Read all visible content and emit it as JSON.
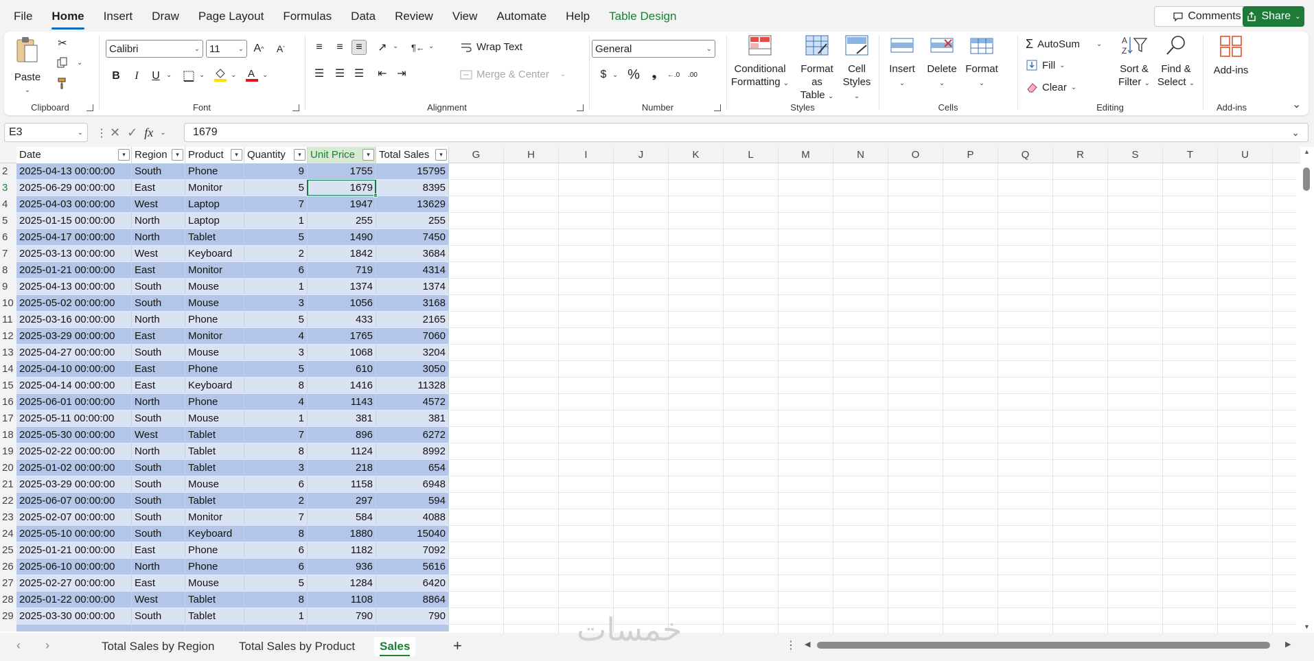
{
  "menu": {
    "tabs": [
      "File",
      "Home",
      "Insert",
      "Draw",
      "Page Layout",
      "Formulas",
      "Data",
      "Review",
      "View",
      "Automate",
      "Help",
      "Table Design"
    ],
    "comments_label": "Comments",
    "share_label": "Share"
  },
  "ribbon": {
    "clipboard": {
      "paste": "Paste",
      "label": "Clipboard"
    },
    "font": {
      "name": "Calibri",
      "size": "11",
      "label": "Font"
    },
    "alignment": {
      "wrap_text": "Wrap Text",
      "merge_center": "Merge & Center",
      "label": "Alignment"
    },
    "number": {
      "format": "General",
      "label": "Number"
    },
    "styles": {
      "conditional_1": "Conditional",
      "conditional_2": "Formatting",
      "format_table_1": "Format as",
      "format_table_2": "Table",
      "cell_styles_1": "Cell",
      "cell_styles_2": "Styles",
      "label": "Styles"
    },
    "cells": {
      "insert": "Insert",
      "delete": "Delete",
      "format": "Format",
      "label": "Cells"
    },
    "editing": {
      "autosum": "AutoSum",
      "fill": "Fill",
      "clear": "Clear",
      "sort_1": "Sort &",
      "sort_2": "Filter",
      "find_1": "Find &",
      "find_2": "Select",
      "label": "Editing"
    },
    "addins": {
      "addins": "Add-ins",
      "label": "Add-ins"
    }
  },
  "formula_bar": {
    "name_box": "E3",
    "value": "1679"
  },
  "columns": [
    "G",
    "H",
    "I",
    "J",
    "K",
    "L",
    "M",
    "N",
    "O",
    "P",
    "Q",
    "R",
    "S",
    "T",
    "U"
  ],
  "table": {
    "headers": [
      "Date",
      "Region",
      "Product",
      "Quantity",
      "Unit Price",
      "Total Sales"
    ],
    "rows": [
      [
        "2",
        "2025-04-13 00:00:00",
        "South",
        "Phone",
        "9",
        "1755",
        "15795"
      ],
      [
        "3",
        "2025-06-29 00:00:00",
        "East",
        "Monitor",
        "5",
        "1679",
        "8395"
      ],
      [
        "4",
        "2025-04-03 00:00:00",
        "West",
        "Laptop",
        "7",
        "1947",
        "13629"
      ],
      [
        "5",
        "2025-01-15 00:00:00",
        "North",
        "Laptop",
        "1",
        "255",
        "255"
      ],
      [
        "6",
        "2025-04-17 00:00:00",
        "North",
        "Tablet",
        "5",
        "1490",
        "7450"
      ],
      [
        "7",
        "2025-03-13 00:00:00",
        "West",
        "Keyboard",
        "2",
        "1842",
        "3684"
      ],
      [
        "8",
        "2025-01-21 00:00:00",
        "East",
        "Monitor",
        "6",
        "719",
        "4314"
      ],
      [
        "9",
        "2025-04-13 00:00:00",
        "South",
        "Mouse",
        "1",
        "1374",
        "1374"
      ],
      [
        "10",
        "2025-05-02 00:00:00",
        "South",
        "Mouse",
        "3",
        "1056",
        "3168"
      ],
      [
        "11",
        "2025-03-16 00:00:00",
        "North",
        "Phone",
        "5",
        "433",
        "2165"
      ],
      [
        "12",
        "2025-03-29 00:00:00",
        "East",
        "Monitor",
        "4",
        "1765",
        "7060"
      ],
      [
        "13",
        "2025-04-27 00:00:00",
        "South",
        "Mouse",
        "3",
        "1068",
        "3204"
      ],
      [
        "14",
        "2025-04-10 00:00:00",
        "East",
        "Phone",
        "5",
        "610",
        "3050"
      ],
      [
        "15",
        "2025-04-14 00:00:00",
        "East",
        "Keyboard",
        "8",
        "1416",
        "11328"
      ],
      [
        "16",
        "2025-06-01 00:00:00",
        "North",
        "Phone",
        "4",
        "1143",
        "4572"
      ],
      [
        "17",
        "2025-05-11 00:00:00",
        "South",
        "Mouse",
        "1",
        "381",
        "381"
      ],
      [
        "18",
        "2025-05-30 00:00:00",
        "West",
        "Tablet",
        "7",
        "896",
        "6272"
      ],
      [
        "19",
        "2025-02-22 00:00:00",
        "North",
        "Tablet",
        "8",
        "1124",
        "8992"
      ],
      [
        "20",
        "2025-01-02 00:00:00",
        "South",
        "Tablet",
        "3",
        "218",
        "654"
      ],
      [
        "21",
        "2025-03-29 00:00:00",
        "South",
        "Mouse",
        "6",
        "1158",
        "6948"
      ],
      [
        "22",
        "2025-06-07 00:00:00",
        "South",
        "Tablet",
        "2",
        "297",
        "594"
      ],
      [
        "23",
        "2025-02-07 00:00:00",
        "South",
        "Monitor",
        "7",
        "584",
        "4088"
      ],
      [
        "24",
        "2025-05-10 00:00:00",
        "South",
        "Keyboard",
        "8",
        "1880",
        "15040"
      ],
      [
        "25",
        "2025-01-21 00:00:00",
        "East",
        "Phone",
        "6",
        "1182",
        "7092"
      ],
      [
        "26",
        "2025-06-10 00:00:00",
        "North",
        "Phone",
        "6",
        "936",
        "5616"
      ],
      [
        "27",
        "2025-02-27 00:00:00",
        "East",
        "Mouse",
        "5",
        "1284",
        "6420"
      ],
      [
        "28",
        "2025-01-22 00:00:00",
        "West",
        "Tablet",
        "8",
        "1108",
        "8864"
      ],
      [
        "29",
        "2025-03-30 00:00:00",
        "South",
        "Tablet",
        "1",
        "790",
        "790"
      ]
    ]
  },
  "sheets": [
    "Total Sales by Region",
    "Total Sales by Product",
    "Sales"
  ],
  "watermark": "خمسات",
  "colors": {
    "table_band_dark": "#b4c6e7",
    "table_band_light": "#dae3f3",
    "accent_green": "#1a7f37",
    "active_tab_blue": "#0f6cbd"
  }
}
